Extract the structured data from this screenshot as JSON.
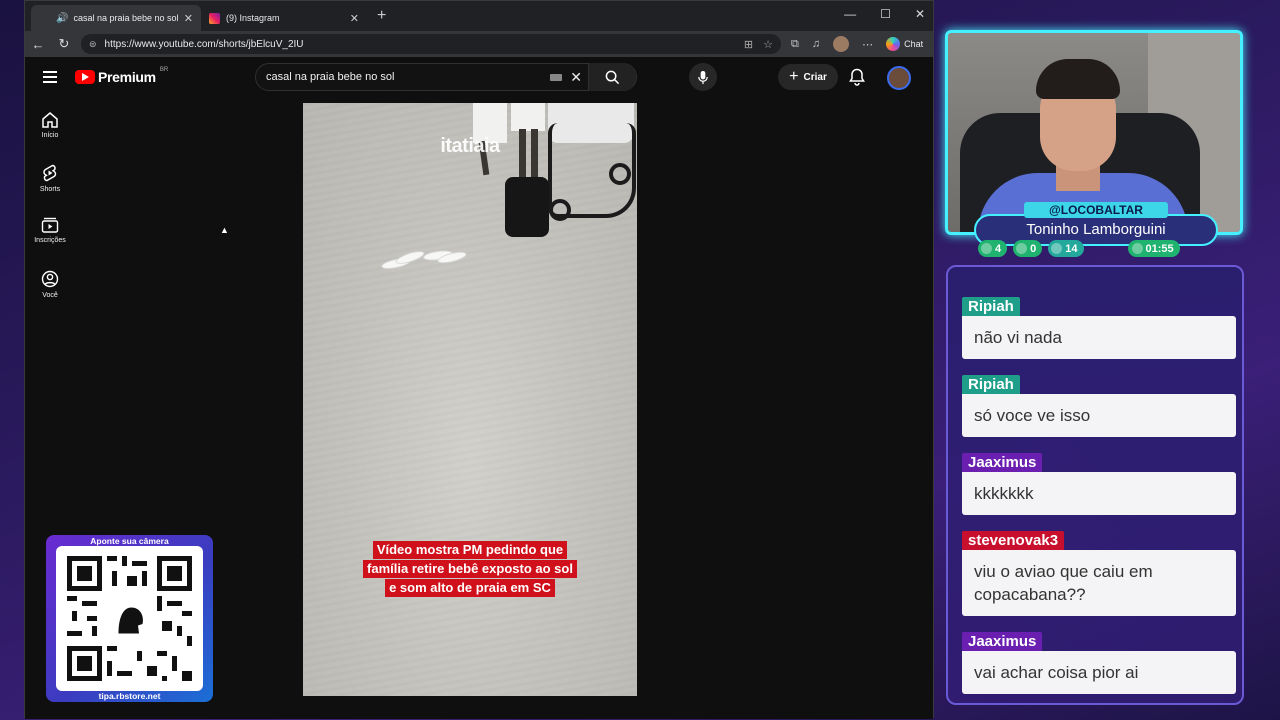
{
  "browser": {
    "tabs": [
      {
        "title": "casal na praia bebe no sol - Yo",
        "active": true
      },
      {
        "title": "(9) Instagram",
        "active": false
      }
    ],
    "url": "https://www.youtube.com/shorts/jbElcuV_2IU",
    "chat_label": "Chat"
  },
  "youtube": {
    "logo_text": "Premium",
    "region": "BR",
    "search_query": "casal na praia bebe no sol",
    "create_label": "Criar",
    "sidebar": [
      {
        "label": "Início",
        "icon": "home-icon"
      },
      {
        "label": "Shorts",
        "icon": "shorts-icon"
      },
      {
        "label": "Inscrições",
        "icon": "subscriptions-icon"
      },
      {
        "label": "Você",
        "icon": "you-icon"
      }
    ],
    "video": {
      "watermark": "itatiaia",
      "caption_lines": [
        "Vídeo mostra PM pedindo que",
        "família retire bebê exposto ao sol",
        "e som alto de praia em SC"
      ]
    }
  },
  "qr": {
    "top_text": "Aponte sua câmera",
    "bottom_text": "tipa.rbstore.net"
  },
  "streamer": {
    "handle": "@LOCOBALTAR",
    "name": "Toninho Lamborguini",
    "stats": [
      "4",
      "0",
      "14",
      "01:55"
    ]
  },
  "chat": {
    "messages": [
      {
        "user": "Ripiah",
        "text": "não vi nada",
        "color": "#1f9e89"
      },
      {
        "user": "Ripiah",
        "text": "só voce ve isso",
        "color": "#1f9e89"
      },
      {
        "user": "Jaaximus",
        "text": "kkkkkkk",
        "color": "#6a1fb0"
      },
      {
        "user": "stevenovak3",
        "text": "viu o aviao que caiu em copacabana??",
        "color": "#c8102e"
      },
      {
        "user": "Jaaximus",
        "text": "vai achar coisa pior ai",
        "color": "#6a1fb0"
      }
    ]
  }
}
